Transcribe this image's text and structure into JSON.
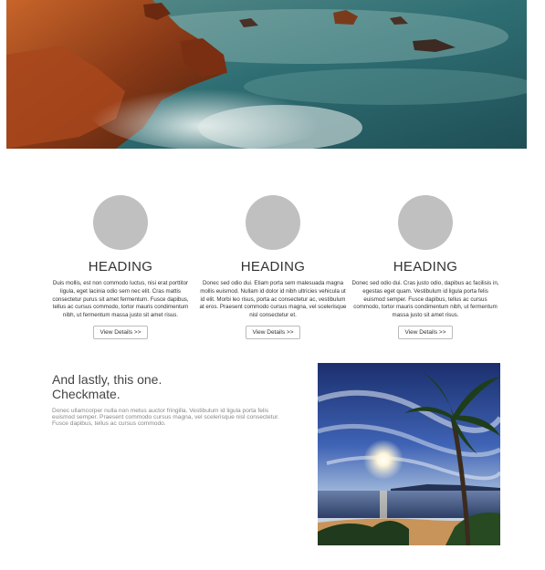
{
  "hero": {
    "image": "rocky-coast-sea-photo"
  },
  "columns": [
    {
      "heading": "HEADING",
      "text": "Duis mollis, est non commodo luctus, nisi erat porttitor ligula, eget lacinia odio sem nec elit. Cras mattis consectetur purus sit amet fermentum. Fusce dapibus, tellus ac cursus commodo, tortor mauris condimentum nibh, ut fermentum massa justo sit amet risus.",
      "button": "View Details >>"
    },
    {
      "heading": "HEADING",
      "text": "Donec sed odio dui. Etiam porta sem malesuada magna mollis euismod. Nullam id dolor id nibh ultricies vehicula ut id elit. Morbi leo risus, porta ac consectetur ac, vestibulum at eros. Praesent commodo cursus magna, vel scelerisque nisl consectetur et.",
      "button": "View Details >>"
    },
    {
      "heading": "HEADING",
      "text": "Donec sed odio dui. Cras justo odio, dapibus ac facilisis in, egestas eget quam. Vestibulum id ligula porta felis euismod semper. Fusce dapibus, tellus ac cursus commodo, tortor mauris condimentum nibh, ut fermentum massa justo sit amet risus.",
      "button": "View Details >>"
    }
  ],
  "feature": {
    "heading_line1": "And lastly, this one.",
    "heading_line2": "Checkmate.",
    "text": "Donec ullamcorper nulla non metus auctor fringilla. Vestibulum id ligula porta felis euismod semper. Praesent commodo cursus magna, vel scelerisque nisl consectetur. Fusce dapibus, tellus ac cursus commodo.",
    "image": "tropical-beach-sunset-photo"
  }
}
